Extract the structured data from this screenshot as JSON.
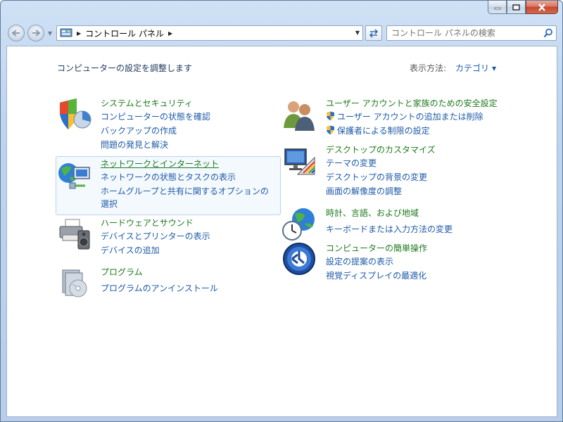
{
  "window": {
    "caption": {
      "minimize_symbol": "",
      "maximize_symbol": "",
      "close_symbol": ""
    }
  },
  "address_bar": {
    "crumb": "コントロール パネル"
  },
  "search": {
    "placeholder": "コントロール パネルの検索"
  },
  "header": {
    "text": "コンピューターの設定を調整します",
    "view_label": "表示方法:",
    "view_value": "カテゴリ"
  },
  "categories": [
    {
      "title": "システムとセキュリティ",
      "links": [
        "コンピューターの状態を確認",
        "バックアップの作成",
        "問題の発見と解決"
      ]
    },
    {
      "title": "ネットワークとインターネット",
      "links": [
        "ネットワークの状態とタスクの表示",
        "ホームグループと共有に関するオプションの",
        "選択"
      ]
    },
    {
      "title": "ハードウェアとサウンド",
      "links": [
        "デバイスとプリンターの表示",
        "デバイスの追加"
      ]
    },
    {
      "title": "プログラム",
      "links": [
        "プログラムのアンインストール"
      ]
    },
    {
      "title": "ユーザー アカウントと家族のための安全設定",
      "links": [
        "ユーザー アカウントの追加または削除",
        "保護者による制限の設定"
      ]
    },
    {
      "title": "デスクトップのカスタマイズ",
      "links": [
        "テーマの変更",
        "デスクトップの背景の変更",
        "画面の解像度の調整"
      ]
    },
    {
      "title": "時計、言語、および地域",
      "links": [
        "キーボードまたは入力方法の変更"
      ]
    },
    {
      "title": "コンピューターの簡単操作",
      "links": [
        "設定の提案の表示",
        "視覚ディスプレイの最適化"
      ]
    }
  ],
  "colors": {
    "title_green": "#1e7a1e",
    "link_blue": "#1e5aa8",
    "accent": "#4f81bd"
  }
}
